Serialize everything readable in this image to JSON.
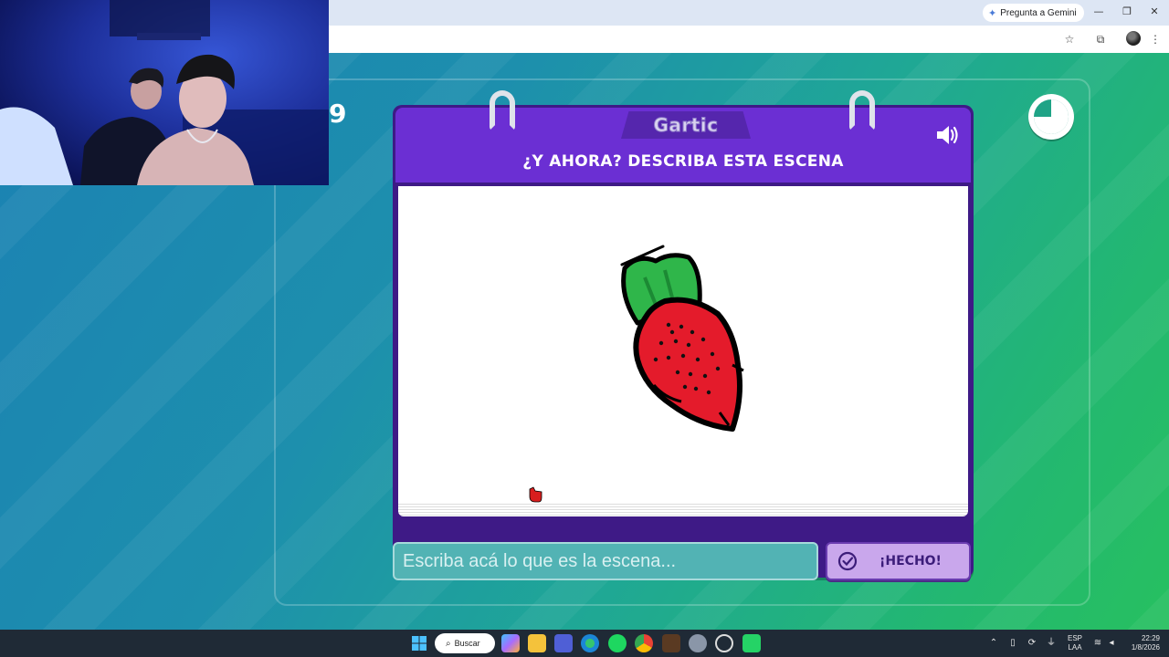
{
  "browser": {
    "gemini_label": "Pregunta a Gemini",
    "minimize_glyph": "—",
    "restore_glyph": "❐",
    "close_glyph": "✕",
    "star_icon": "☆",
    "extensions_icon": "⧉",
    "menu_icon": "⋮"
  },
  "game": {
    "round_number": "9",
    "logo": "Gartic",
    "prompt": "¿Y AHORA? DESCRIBA ESTA ESCENA",
    "answer_placeholder": "Escriba acá lo que es la escena...",
    "done_label": "¡HECHO!",
    "timer_remaining_fraction": 0.75,
    "colors": {
      "header_purple": "#6b2fd3",
      "card_dark": "#3e1a86",
      "done_button": "#c9a7ec",
      "input_teal": "#52b3b4",
      "leaf_green": "#2fb64a",
      "fruit_red": "#e41b2b"
    }
  },
  "taskbar": {
    "search_label": "Buscar",
    "apps": [
      "windows-start-icon",
      "copilot-icon",
      "file-explorer-icon",
      "teams-icon",
      "edge-icon",
      "spotify-icon",
      "chrome-icon",
      "game-icon",
      "settings-icon",
      "xbox-icon",
      "whatsapp-icon"
    ],
    "lang_top": "ESP",
    "lang_bottom": "LAA",
    "time": "22:29",
    "date": "1/8/2026"
  }
}
